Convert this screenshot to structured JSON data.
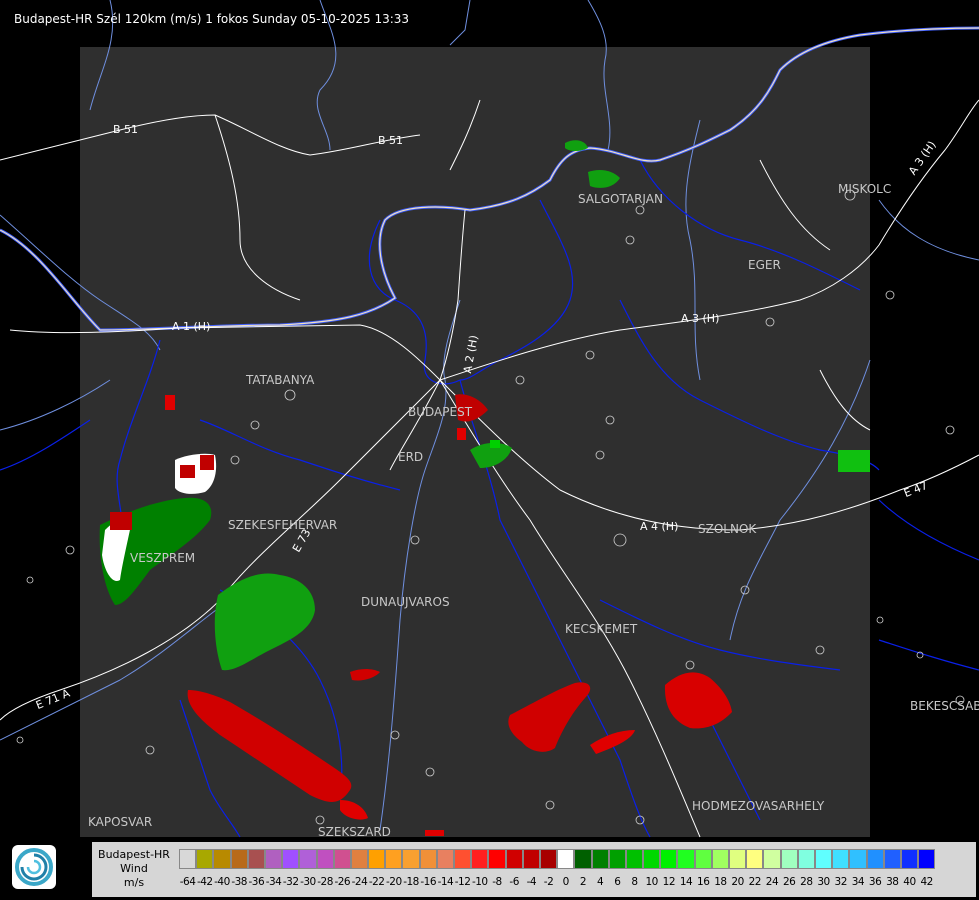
{
  "title": "Budapest-HR Szél 120km (m/s) 1 fokos Sunday 05-10-2025 13:33",
  "places": [
    {
      "key": "salgotarjan",
      "label": "SALGOTARJAN"
    },
    {
      "key": "miskolc",
      "label": "MISKOLC"
    },
    {
      "key": "eger",
      "label": "EGER"
    },
    {
      "key": "tatabanya",
      "label": "TATABANYA"
    },
    {
      "key": "budapest",
      "label": "BUDAPEST"
    },
    {
      "key": "erd",
      "label": "ERD"
    },
    {
      "key": "szekesfehervar",
      "label": "SZEKESFEHERVAR"
    },
    {
      "key": "veszprem",
      "label": "VESZPREM"
    },
    {
      "key": "dunaujvaros",
      "label": "DUNAUJVAROS"
    },
    {
      "key": "kecskemet",
      "label": "KECSKEMET"
    },
    {
      "key": "szolnok",
      "label": "SZOLNOK"
    },
    {
      "key": "bekescsaba",
      "label": "BEKESCSABA"
    },
    {
      "key": "hodmezovasarhely",
      "label": "HODMEZOVASARHELY"
    },
    {
      "key": "kaposvar",
      "label": "KAPOSVAR"
    },
    {
      "key": "szekszard",
      "label": "SZEKSZARD"
    }
  ],
  "roads": {
    "b51_left": "B 51",
    "b51_right": "B 51",
    "a1": "A 1 (H)",
    "a2": "A 2 (H)",
    "a3": "A 3 (H)",
    "a3_ne": "A 3 (H)",
    "a4": "A 4 (H)",
    "e47": "E 47",
    "e71": "E 71 A",
    "e73": "E 73"
  },
  "legend": {
    "line1": "Budapest-HR",
    "line2": "Wind",
    "line3": "m/s",
    "values": [
      "-64",
      "-42",
      "-40",
      "-38",
      "-36",
      "-34",
      "-32",
      "-30",
      "-28",
      "-26",
      "-24",
      "-22",
      "-20",
      "-18",
      "-16",
      "-14",
      "-12",
      "-10",
      "-8",
      "-6",
      "-4",
      "-2",
      "0",
      "2",
      "4",
      "6",
      "8",
      "10",
      "12",
      "14",
      "16",
      "18",
      "20",
      "22",
      "24",
      "26",
      "28",
      "30",
      "32",
      "34",
      "36",
      "38",
      "40",
      "42"
    ],
    "colors": [
      "#d8d8d8",
      "#a8a800",
      "#b88a00",
      "#b86a1a",
      "#a85050",
      "#b060c0",
      "#a050ff",
      "#b060d8",
      "#c050c0",
      "#d05090",
      "#e08040",
      "#ffa000",
      "#ffa020",
      "#f8a030",
      "#f09038",
      "#e88060",
      "#ff5030",
      "#ff2020",
      "#ff0000",
      "#d00000",
      "#c00000",
      "#a80000",
      "#ffffff",
      "#006000",
      "#008000",
      "#00a000",
      "#00c000",
      "#00d800",
      "#00f000",
      "#20ff20",
      "#60ff40",
      "#a0ff60",
      "#e0ff80",
      "#ffff80",
      "#d0ffa0",
      "#a0ffc0",
      "#80ffe0",
      "#60ffff",
      "#40e0ff",
      "#30c0ff",
      "#2090ff",
      "#2060ff",
      "#1030ff",
      "#0000ff"
    ]
  },
  "colors": {
    "background": "#000000",
    "radar_area": "#2f2f2f",
    "roads": "#ffffff",
    "borders": "#0018ff",
    "rivers": "#6f8fdf"
  },
  "logo_icon": "weather-service-logo-icon"
}
